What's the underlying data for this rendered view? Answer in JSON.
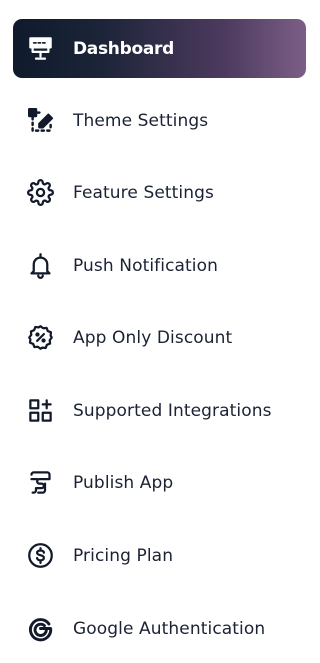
{
  "sidebar": {
    "colors": {
      "active_gradient_start": "#0f1a2c",
      "active_gradient_end": "#7c5e86",
      "text": "#1a2233",
      "active_text": "#ffffff"
    },
    "items": [
      {
        "label": "Dashboard",
        "icon": "dashboard-icon",
        "active": true
      },
      {
        "label": "Theme Settings",
        "icon": "theme-settings-icon",
        "active": false
      },
      {
        "label": "Feature Settings",
        "icon": "gear-icon",
        "active": false
      },
      {
        "label": "Push Notification",
        "icon": "bell-icon",
        "active": false
      },
      {
        "label": "App Only Discount",
        "icon": "discount-icon",
        "active": false
      },
      {
        "label": "Supported Integrations",
        "icon": "integrations-icon",
        "active": false
      },
      {
        "label": "Publish App",
        "icon": "publish-app-icon",
        "active": false
      },
      {
        "label": "Pricing Plan",
        "icon": "dollar-icon",
        "active": false
      },
      {
        "label": "Google Authentication",
        "icon": "google-icon",
        "active": false
      }
    ]
  }
}
